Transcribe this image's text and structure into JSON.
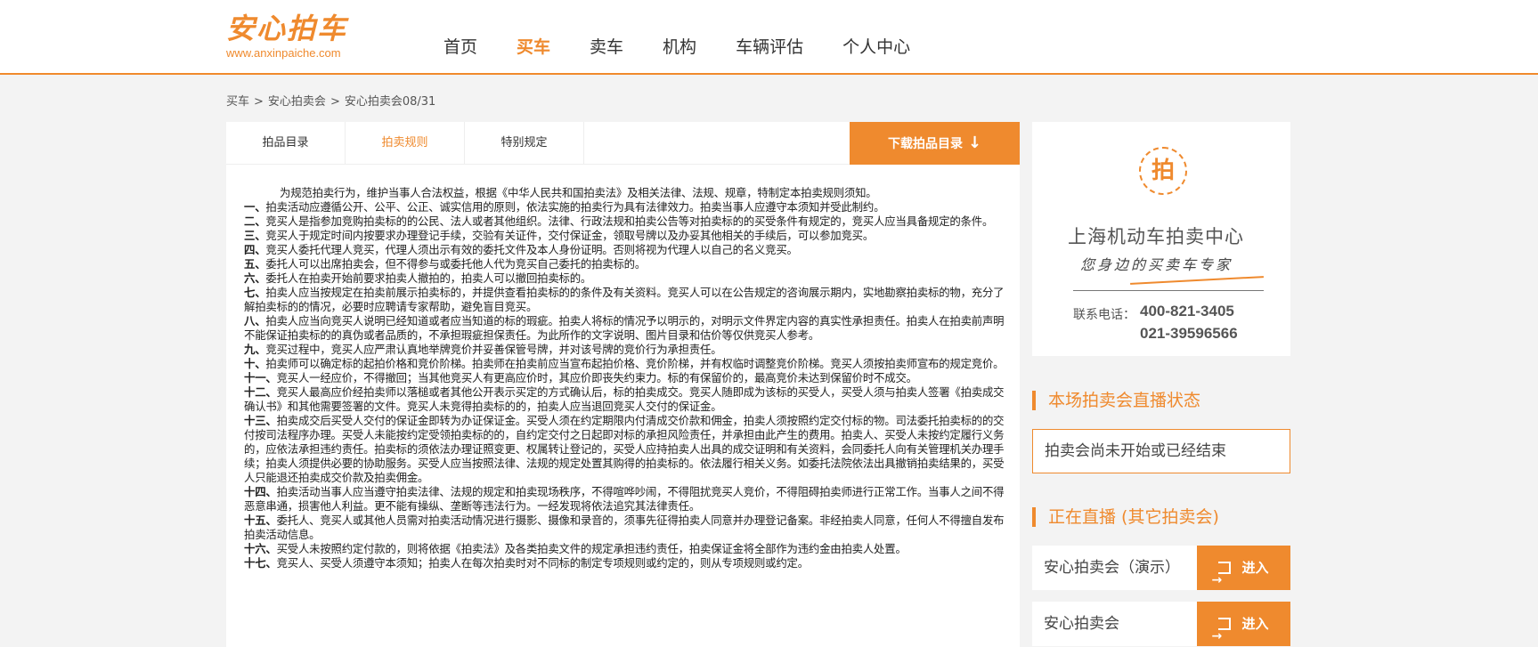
{
  "header": {
    "logo_text": "安心拍车",
    "logo_url": "www.anxinpaiche.com",
    "nav": [
      {
        "label": "首页",
        "active": false
      },
      {
        "label": "买车",
        "active": true
      },
      {
        "label": "卖车",
        "active": false
      },
      {
        "label": "机构",
        "active": false
      },
      {
        "label": "车辆评估",
        "active": false
      },
      {
        "label": "个人中心",
        "active": false
      }
    ]
  },
  "breadcrumb": [
    "买车",
    "安心拍卖会",
    "安心拍卖会08/31"
  ],
  "tabs": [
    {
      "label": "拍品目录",
      "active": false
    },
    {
      "label": "拍卖规则",
      "active": true
    },
    {
      "label": "特别规定",
      "active": false
    }
  ],
  "download_label": "下载拍品目录",
  "rules": {
    "intro": "为规范拍卖行为，维护当事人合法权益，根据《中华人民共和国拍卖法》及相关法律、法规、规章，特制定本拍卖规则须知。",
    "items": [
      {
        "num": "一、",
        "text": "拍卖活动应遵循公开、公平、公正、诚实信用的原则，依法实施的拍卖行为具有法律效力。拍卖当事人应遵守本须知并受此制约。"
      },
      {
        "num": "二、",
        "text": "竞买人是指参加竞购拍卖标的的公民、法人或者其他组织。法律、行政法规和拍卖公告等对拍卖标的的买受条件有规定的，竞买人应当具备规定的条件。"
      },
      {
        "num": "三、",
        "text": "竞买人于规定时间内按要求办理登记手续，交验有关证件，交付保证金，领取号牌以及办妥其他相关的手续后，可以参加竞买。"
      },
      {
        "num": "四、",
        "text": "竞买人委托代理人竞买，代理人须出示有效的委托文件及本人身份证明。否则将视为代理人以自己的名义竞买。"
      },
      {
        "num": "五、",
        "text": "委托人可以出席拍卖会，但不得参与或委托他人代为竞买自己委托的拍卖标的。"
      },
      {
        "num": "六、",
        "text": "委托人在拍卖开始前要求拍卖人撤拍的，拍卖人可以撤回拍卖标的。"
      },
      {
        "num": "七、",
        "text": "拍卖人应当按规定在拍卖前展示拍卖标的，并提供查看拍卖标的的条件及有关资料。竞买人可以在公告规定的咨询展示期内，实地勘察拍卖标的物，充分了解拍卖标的的情况，必要时应聘请专家帮助，避免盲目竞买。"
      },
      {
        "num": "八、",
        "text": "拍卖人应当向竞买人说明已经知道或者应当知道的标的瑕疵。拍卖人将标的情况予以明示的，对明示文件界定内容的真实性承担责任。拍卖人在拍卖前声明不能保证拍卖标的的真伪或者品质的，不承担瑕疵担保责任。为此所作的文字说明、图片目录和估价等仅供竞买人参考。"
      },
      {
        "num": "九、",
        "text": "竞买过程中，竞买人应严肃认真地举牌竞价并妥善保管号牌，并对该号牌的竞价行为承担责任。"
      },
      {
        "num": "十、",
        "text": "拍卖师可以确定标的起拍价格和竞价阶梯。拍卖师在拍卖前应当宣布起拍价格、竞价阶梯，并有权临时调整竞价阶梯。竞买人须按拍卖师宣布的规定竞价。"
      },
      {
        "num": "十一、",
        "text": "竞买人一经应价，不得撤回；当其他竞买人有更高应价时，其应价即丧失约束力。标的有保留价的，最高竞价未达到保留价时不成交。"
      },
      {
        "num": "十二、",
        "text": "竞买人最高应价经拍卖师以落槌或者其他公开表示买定的方式确认后，标的拍卖成交。竞买人随即成为该标的买受人，买受人须与拍卖人签署《拍卖成交确认书》和其他需要签署的文件。竞买人未竞得拍卖标的的，拍卖人应当退回竞买人交付的保证金。"
      },
      {
        "num": "十三、",
        "text": "拍卖成交后买受人交付的保证金即转为办证保证金。买受人须在约定期限内付清成交价款和佣金，拍卖人须按照约定交付标的物。司法委托拍卖标的的交付按司法程序办理。买受人未能按约定受领拍卖标的的，自约定交付之日起即对标的承担风险责任，并承担由此产生的费用。拍卖人、买受人未按约定履行义务的，应依法承担违约责任。拍卖标的须依法办理证照变更、权属转让登记的，买受人应持拍卖人出具的成交证明和有关资料，会同委托人向有关管理机关办理手续；拍卖人须提供必要的协助服务。买受人应当按照法律、法规的规定处置其购得的拍卖标的。依法履行相关义务。如委托法院依法出具撤销拍卖结果的，买受人只能退还拍卖成交价款及拍卖佣金。"
      },
      {
        "num": "十四、",
        "text": "拍卖活动当事人应当遵守拍卖法律、法规的规定和拍卖现场秩序，不得喧哗吵闹，不得阻扰竞买人竞价，不得阻碍拍卖师进行正常工作。当事人之间不得恶意串通，损害他人利益。更不能有操纵、垄断等违法行为。一经发现将依法追究其法律责任。"
      },
      {
        "num": "十五、",
        "text": "委托人、竞买人或其他人员需对拍卖活动情况进行摄影、摄像和录音的，须事先征得拍卖人同意并办理登记备案。非经拍卖人同意，任何人不得擅自发布拍卖活动信息。"
      },
      {
        "num": "十六、",
        "text": "买受人未按照约定付款的，则将依据《拍卖法》及各类拍卖文件的规定承担违约责任，拍卖保证金将全部作为违约金由拍卖人处置。"
      },
      {
        "num": "十七、",
        "text": "竞买人、买受人须遵守本须知；拍卖人在每次拍卖时对不同标的制定专项规则或约定的，则从专项规则或约定。"
      }
    ]
  },
  "side": {
    "brand_name": "上海机动车拍卖中心",
    "brand_slogan": "您身边的买卖车专家",
    "phone_label": "联系电话：",
    "phone1": "400-821-3405",
    "phone2": "021-39596566",
    "status_title": "本场拍卖会直播状态",
    "status_text": "拍卖会尚未开始或已经结束",
    "live_title": "正在直播 (其它拍卖会)",
    "live_items": [
      {
        "name": "安心拍卖会（演示）",
        "button": "进入"
      },
      {
        "name": "安心拍卖会",
        "button": "进入"
      }
    ]
  },
  "colors": {
    "accent": "#ef8a2e",
    "background": "#f3f3f3"
  }
}
